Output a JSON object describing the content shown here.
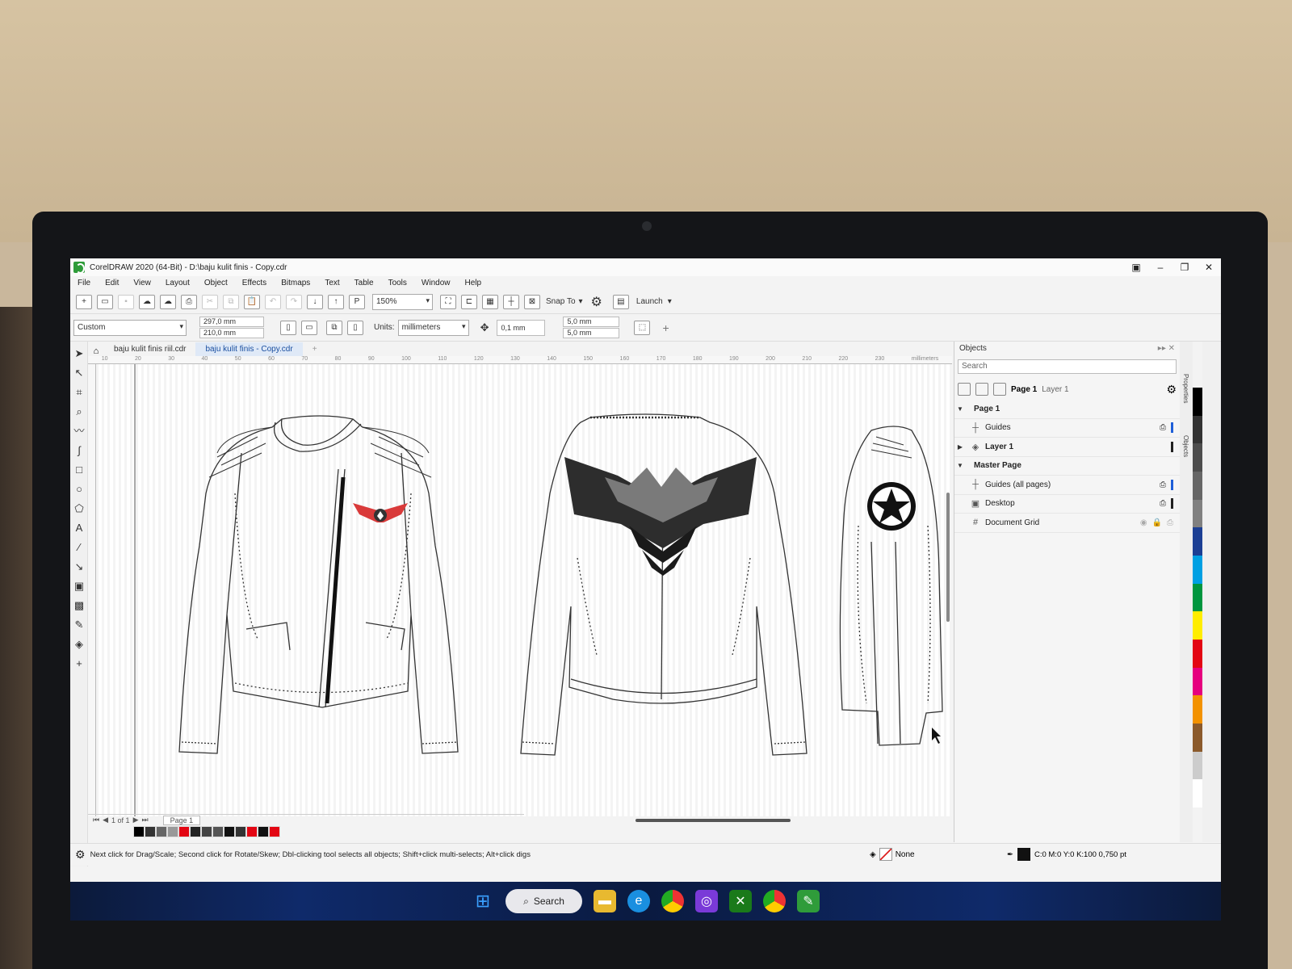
{
  "window": {
    "title": "CorelDRAW 2020 (64-Bit) - D:\\baju kulit finis - Copy.cdr"
  },
  "menu": [
    "File",
    "Edit",
    "View",
    "Layout",
    "Object",
    "Effects",
    "Bitmaps",
    "Text",
    "Table",
    "Tools",
    "Window",
    "Help"
  ],
  "toolbar": {
    "zoom": "150%",
    "snap_to": "Snap To",
    "launch": "Launch"
  },
  "propbar": {
    "page_preset": "Custom",
    "width": "297,0 mm",
    "height": "210,0 mm",
    "units_label": "Units:",
    "units": "millimeters",
    "nudge": "0,1 mm",
    "dup_x": "5,0 mm",
    "dup_y": "5,0 mm"
  },
  "tabs": [
    {
      "label": "baju kulit finis riil.cdr",
      "active": false
    },
    {
      "label": "baju kulit finis - Copy.cdr",
      "active": true
    }
  ],
  "ruler": {
    "unit": "millimeters",
    "ticks": [
      "10",
      "20",
      "30",
      "40",
      "50",
      "60",
      "70",
      "80",
      "90",
      "100",
      "110",
      "120",
      "130",
      "140",
      "150",
      "160",
      "170",
      "180",
      "190",
      "200",
      "210",
      "220",
      "230"
    ]
  },
  "page_nav": {
    "counter": "1 of 1",
    "page_tab": "Page 1"
  },
  "objects_panel": {
    "title": "Objects",
    "search_placeholder": "Search",
    "current_page": "Page 1",
    "current_layer": "Layer 1",
    "tree": [
      {
        "label": "Page 1",
        "level": 0,
        "expanded": true,
        "bold": true
      },
      {
        "label": "Guides",
        "level": 1,
        "bold": false
      },
      {
        "label": "Layer 1",
        "level": 1,
        "bold": true
      },
      {
        "label": "Master Page",
        "level": 0,
        "expanded": true,
        "bold": true
      },
      {
        "label": "Guides (all pages)",
        "level": 1,
        "bold": false
      },
      {
        "label": "Desktop",
        "level": 1,
        "bold": false
      },
      {
        "label": "Document Grid",
        "level": 1,
        "bold": false
      }
    ]
  },
  "side_tabs": [
    "Properties",
    "Objects"
  ],
  "status": {
    "hint": "Next click for Drag/Scale; Second click for Rotate/Skew; Dbl-clicking tool selects all objects; Shift+click multi-selects; Alt+click digs",
    "fill": "None",
    "outline": "C:0 M:0 Y:0 K:100  0,750 pt"
  },
  "taskbar": {
    "search_label": "Search"
  },
  "colors": {
    "accent": "#1a4fa0",
    "corel_green": "#2f9c3a",
    "palette": [
      "#000000",
      "#333333",
      "#4d4d4d",
      "#666666",
      "#808080",
      "#1c3f94",
      "#00a0e3",
      "#00963f",
      "#ffed00",
      "#e30613",
      "#e6007e",
      "#f39200",
      "#8b5a2b",
      "#cccccc",
      "#ffffff"
    ]
  }
}
